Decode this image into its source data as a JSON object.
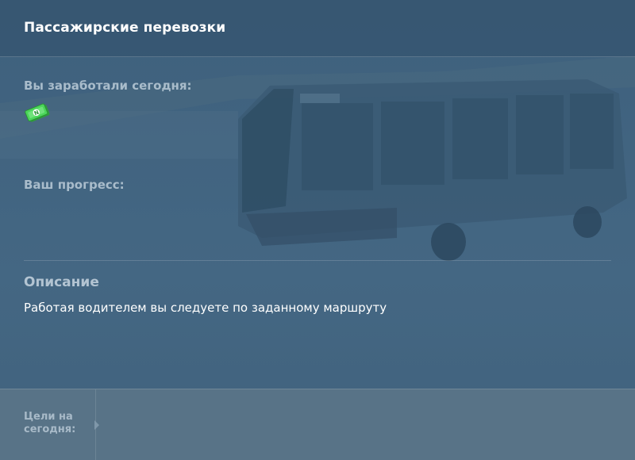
{
  "header": {
    "title": "Пассажирские перевозки"
  },
  "earnings": {
    "label": "Вы заработали сегодня:",
    "icon": "cash-icon"
  },
  "progress": {
    "label": "Ваш прогресс:"
  },
  "description": {
    "title": "Описание",
    "text": "Работая водителем вы следуете по заданному маршруту"
  },
  "footer": {
    "goals_label": "Цели на сегодня:"
  },
  "colors": {
    "background": "#3f6280",
    "footer": "#587387",
    "label": "#a9bccb",
    "money": "#3ec94a"
  }
}
